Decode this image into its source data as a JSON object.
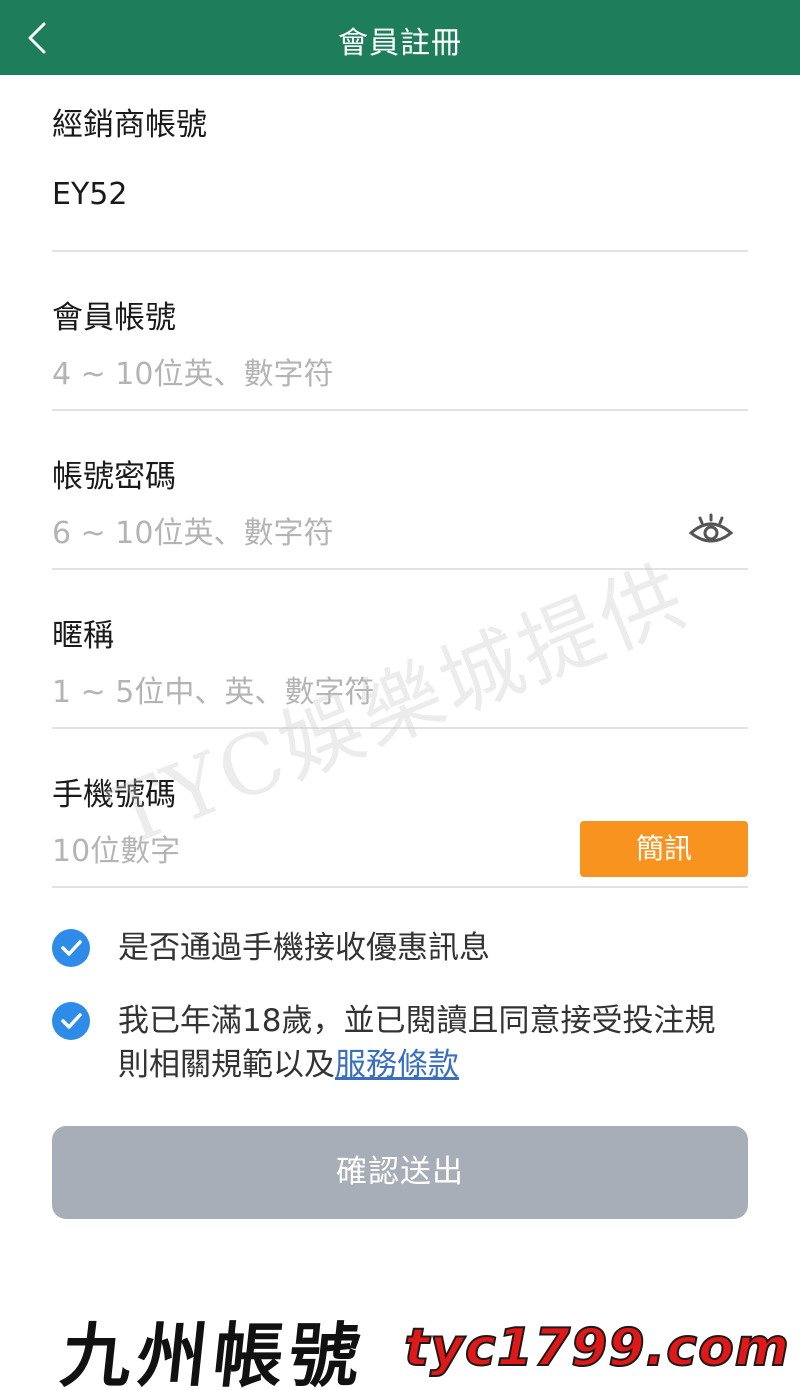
{
  "header": {
    "title": "會員註冊"
  },
  "fields": {
    "dealer": {
      "label": "經銷商帳號",
      "value": "EY52"
    },
    "account": {
      "label": "會員帳號",
      "placeholder": "4 ~ 10位英、數字符"
    },
    "password": {
      "label": "帳號密碼",
      "placeholder": "6 ~ 10位英、數字符"
    },
    "nickname": {
      "label": "暱稱",
      "placeholder": "1 ~ 5位中、英、數字符"
    },
    "phone": {
      "label": "手機號碼",
      "placeholder": "10位數字",
      "sms_label": "簡訊"
    }
  },
  "checks": {
    "promo": {
      "text": "是否通過手機接收優惠訊息",
      "checked": true
    },
    "agree": {
      "text": "我已年滿18歲，並已閱讀且同意接受投注規則相關規範以及",
      "link": "服務條款",
      "checked": true
    }
  },
  "submit": {
    "label": "確認送出"
  },
  "watermarks": {
    "center": "TYC娛樂城提供",
    "left": "九州帳號",
    "right": "tyc1799.com"
  },
  "colors": {
    "header": "#1e7e5c",
    "sms_button": "#f7931e",
    "check": "#2f8be8",
    "link": "#3a6fc0",
    "submit_disabled": "#a7aeb8"
  },
  "icons": {
    "back": "chevron-left-icon",
    "eye": "eye-icon",
    "check": "checkmark-circle-icon"
  }
}
